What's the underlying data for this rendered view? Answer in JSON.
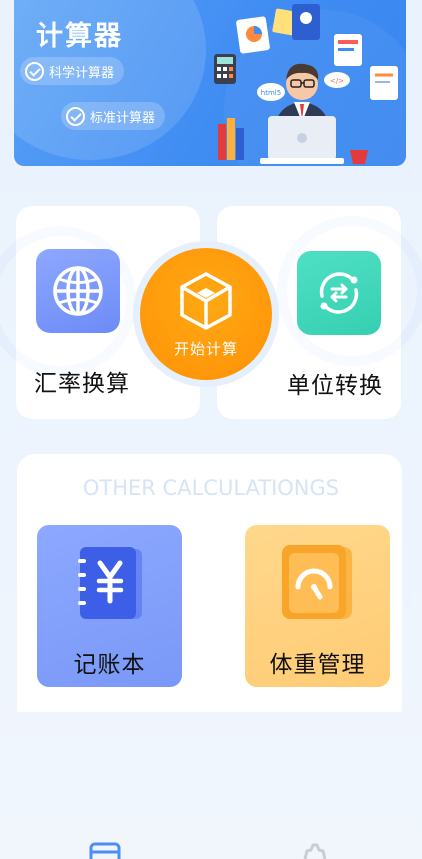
{
  "banner": {
    "title": "计算器",
    "pills": {
      "scientific": "科学计算器",
      "standard": "标准计算器"
    },
    "illustration_tags": {
      "html": "html5",
      "code": "</>"
    }
  },
  "main": {
    "exchange": {
      "label": "汇率换算",
      "icon": "globe-icon"
    },
    "start": {
      "label": "开始计算",
      "icon": "cube-icon"
    },
    "unit": {
      "label": "单位转换",
      "icon": "exchange-arrows-icon"
    }
  },
  "other": {
    "title": "OTHER CALCULATIONGS",
    "items": [
      {
        "label": "记账本",
        "icon": "yen-notebook-icon"
      },
      {
        "label": "体重管理",
        "icon": "scale-gauge-icon"
      }
    ]
  },
  "nav": {
    "items": [
      {
        "icon": "calculator-tab-icon"
      },
      {
        "icon": "gear-icon"
      }
    ]
  },
  "colors": {
    "banner": "#3f8cf3",
    "start": "#ff9c0f",
    "globe_tile": "#7b96fa",
    "unit_tile": "#42d8bb",
    "book_tile": "#809ef8",
    "weight_tile": "#ffd07c"
  }
}
